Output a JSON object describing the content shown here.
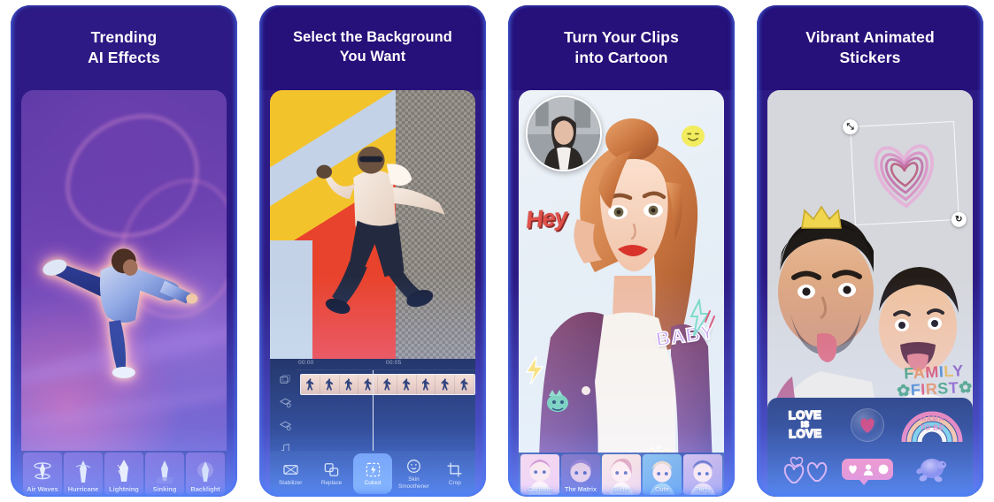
{
  "gallery": {
    "panels": [
      {
        "id": "trending-ai-effects",
        "headline": "Trending\nAI Effects",
        "header_bg": "#2d1a84",
        "effects": [
          {
            "label": "Air Waves"
          },
          {
            "label": "Hurricane"
          },
          {
            "label": "Lightning"
          },
          {
            "label": "Sinking"
          },
          {
            "label": "Backlight"
          }
        ]
      },
      {
        "id": "select-background",
        "headline": "Select the Background\nYou Want",
        "header_bg": "#2d1a84",
        "timeline": {
          "time_start": "00:00",
          "time_mid": "00:05",
          "tracks": [
            "clips-track-icon",
            "overlay-track-icon",
            "effect-track-icon",
            "audio-track-icon"
          ]
        },
        "tools": [
          {
            "label": "Stabilizer",
            "icon": "stabilizer-icon",
            "active": false
          },
          {
            "label": "Replace",
            "icon": "replace-icon",
            "active": false
          },
          {
            "label": "Cutout",
            "icon": "cutout-icon",
            "active": true
          },
          {
            "label": "Skin\nSmoothener",
            "icon": "skin-smoothener-icon",
            "active": false
          },
          {
            "label": "Crop",
            "icon": "crop-icon",
            "active": false
          }
        ],
        "accent_color": "#5b7df0"
      },
      {
        "id": "clips-into-cartoon",
        "headline": "Turn Your Clips\ninto Cartoon",
        "header_bg": "#2d1a84",
        "stickers": {
          "hey": "Hey",
          "baby": "BABY",
          "cutie": "cutie"
        },
        "styles": [
          {
            "label": "Cartoon"
          },
          {
            "label": "The Matrix"
          },
          {
            "label": "Glitter"
          },
          {
            "label": "Cute"
          },
          {
            "label": "Party"
          }
        ]
      },
      {
        "id": "animated-stickers",
        "headline": "Vibrant Animated\nStickers",
        "header_bg": "#2d1a84",
        "canvas": {
          "selected_sticker": "neon-heart-sticker",
          "handles": [
            {
              "name": "resize-handle",
              "glyph": "⤡"
            },
            {
              "name": "rotate-handle",
              "glyph": "↻"
            }
          ],
          "shirt_text_line1": "FAMILY",
          "shirt_text_line2": "FIRST"
        },
        "tray": [
          {
            "name": "love-is-love-sticker",
            "line1": "LOVE",
            "line2": "IS",
            "line3": "LOVE"
          },
          {
            "name": "heart-bubble-sticker",
            "label": ""
          },
          {
            "name": "mama-to-be-sticker",
            "label": "MAMA\nTO BE"
          },
          {
            "name": "outline-hearts-sticker",
            "label": ""
          },
          {
            "name": "social-reactions-sticker",
            "label": ""
          },
          {
            "name": "purple-turtle-sticker",
            "label": ""
          }
        ]
      }
    ]
  }
}
